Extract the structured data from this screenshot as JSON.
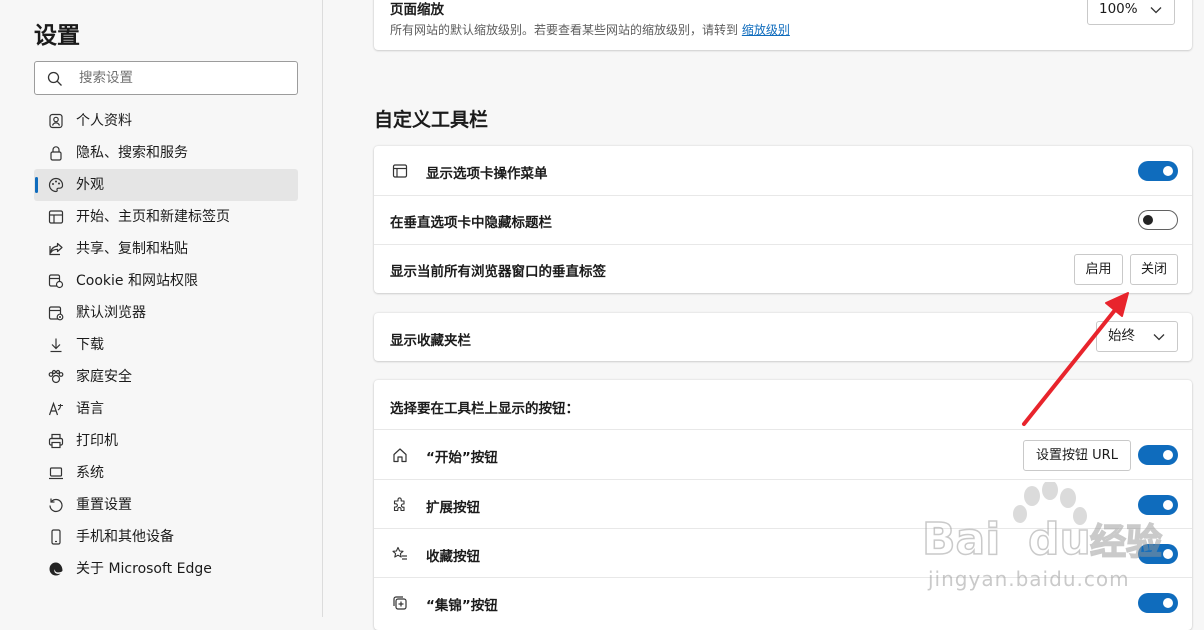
{
  "sidebar": {
    "title": "设置",
    "search": {
      "placeholder": "搜索设置"
    },
    "items": [
      {
        "label": "个人资料",
        "icon": "profile-icon"
      },
      {
        "label": "隐私、搜索和服务",
        "icon": "lock-icon"
      },
      {
        "label": "外观",
        "icon": "palette-icon",
        "active": true
      },
      {
        "label": "开始、主页和新建标签页",
        "icon": "home-grid-icon"
      },
      {
        "label": "共享、复制和粘贴",
        "icon": "share-icon"
      },
      {
        "label": "Cookie 和网站权限",
        "icon": "cookie-icon"
      },
      {
        "label": "默认浏览器",
        "icon": "default-browser-icon"
      },
      {
        "label": "下载",
        "icon": "download-icon"
      },
      {
        "label": "家庭安全",
        "icon": "family-icon"
      },
      {
        "label": "语言",
        "icon": "language-icon"
      },
      {
        "label": "打印机",
        "icon": "printer-icon"
      },
      {
        "label": "系统",
        "icon": "laptop-icon"
      },
      {
        "label": "重置设置",
        "icon": "reset-icon"
      },
      {
        "label": "手机和其他设备",
        "icon": "phone-icon"
      },
      {
        "label": "关于 Microsoft Edge",
        "icon": "edge-logo-icon"
      }
    ]
  },
  "zoom": {
    "label": "页面缩放",
    "description": "所有网站的默认缩放级别。若要查看某些网站的缩放级别，请转到",
    "link": "缩放级别",
    "value": "100%"
  },
  "toolbar_section": {
    "title": "自定义工具栏",
    "tab_menu": {
      "label": "显示选项卡操作菜单",
      "icon": "tab-window-icon",
      "enabled": true
    },
    "hide_title_bar": {
      "label": "在垂直选项卡中隐藏标题栏",
      "enabled": false
    },
    "vertical_tabs": {
      "label": "显示当前所有浏览器窗口的垂直标签",
      "on_label": "启用",
      "off_label": "关闭"
    },
    "favorites_bar": {
      "label": "显示收藏夹栏",
      "value": "始终"
    },
    "buttons_header": "选择要在工具栏上显示的按钮：",
    "buttons": [
      {
        "label": "“开始”按钮",
        "icon": "home-icon",
        "enabled": true,
        "extra": "设置按钮 URL"
      },
      {
        "label": "扩展按钮",
        "icon": "puzzle-icon",
        "enabled": true
      },
      {
        "label": "收藏按钮",
        "icon": "favorites-star-icon",
        "enabled": true
      },
      {
        "label": "“集锦”按钮",
        "icon": "collections-icon",
        "enabled": true
      }
    ]
  },
  "colors": {
    "accent": "#0f6cbd",
    "arrow": "#e8242c",
    "background": "#f7f7f7"
  },
  "watermark": {
    "brand": "Bai",
    "brand2": "du",
    "cn": "经验",
    "url": "jingyan.baidu.com"
  }
}
